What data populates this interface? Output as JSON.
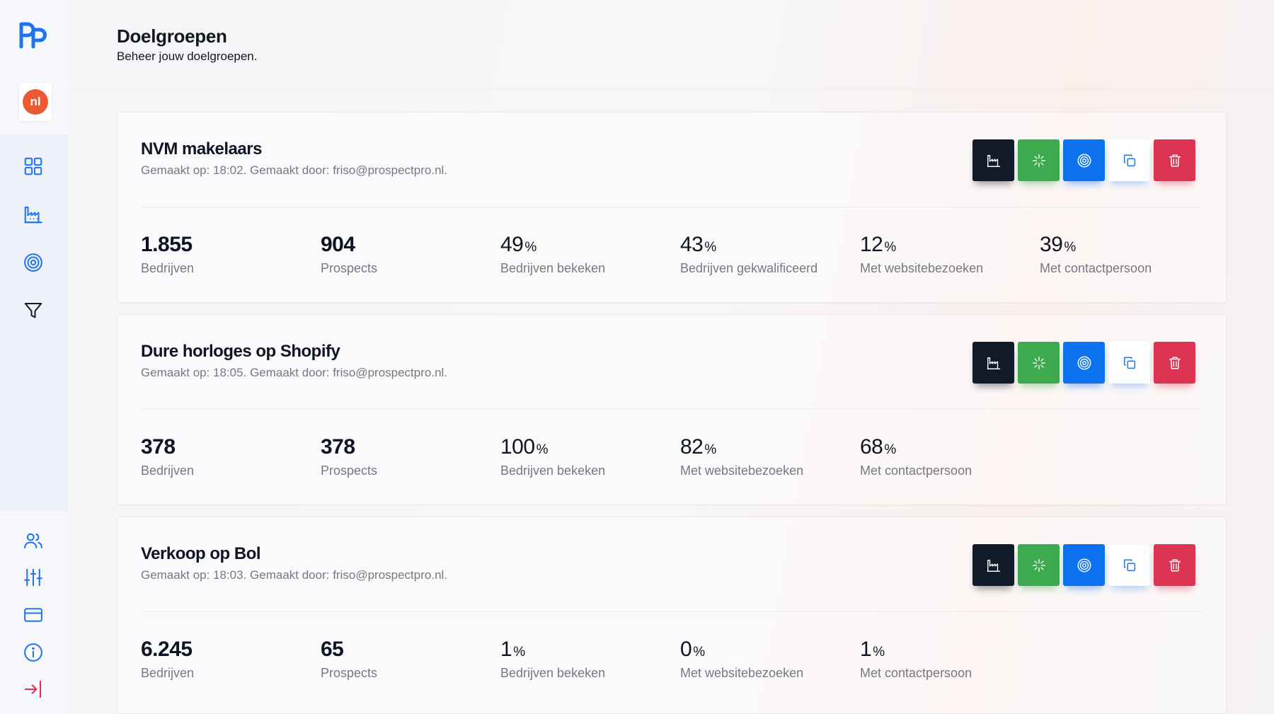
{
  "app": {
    "logo": "prospectpro-logo",
    "language": "nl"
  },
  "nav": {
    "top_icons": [
      "dashboard-icon",
      "companies-icon",
      "target-icon",
      "filter-icon"
    ],
    "bottom_icons": [
      "users-icon",
      "settings-sliders-icon",
      "billing-card-icon",
      "info-icon",
      "logout-icon"
    ]
  },
  "header": {
    "title": "Doelgroepen",
    "subtitle": "Beheer jouw doelgroepen."
  },
  "colors": {
    "dark": "#111a28",
    "green": "#3daa4f",
    "blue": "#0c72f0",
    "red": "#dc3352",
    "accent_orange": "#ec5a33"
  },
  "action_icons": [
    "companies-icon",
    "sparkle-icon",
    "target-icon",
    "copy-icon",
    "trash-icon"
  ],
  "cards": [
    {
      "title": "NVM makelaars",
      "meta": "Gemaakt op: 18:02. Gemaakt door: friso@prospectpro.nl.",
      "stats": [
        {
          "value": "1.855",
          "pct": "",
          "label": "Bedrijven"
        },
        {
          "value": "904",
          "pct": "",
          "label": "Prospects"
        },
        {
          "value": "49",
          "pct": "%",
          "label": "Bedrijven bekeken"
        },
        {
          "value": "43",
          "pct": "%",
          "label": "Bedrijven gekwalificeerd"
        },
        {
          "value": "12",
          "pct": "%",
          "label": "Met websitebezoeken"
        },
        {
          "value": "39",
          "pct": "%",
          "label": "Met contactpersoon"
        }
      ]
    },
    {
      "title": "Dure horloges op Shopify",
      "meta": "Gemaakt op: 18:05. Gemaakt door: friso@prospectpro.nl.",
      "stats": [
        {
          "value": "378",
          "pct": "",
          "label": "Bedrijven"
        },
        {
          "value": "378",
          "pct": "",
          "label": "Prospects"
        },
        {
          "value": "100",
          "pct": "%",
          "label": "Bedrijven bekeken"
        },
        {
          "value": "82",
          "pct": "%",
          "label": "Met websitebezoeken"
        },
        {
          "value": "68",
          "pct": "%",
          "label": "Met contactpersoon"
        }
      ]
    },
    {
      "title": "Verkoop op Bol",
      "meta": "Gemaakt op: 18:03. Gemaakt door: friso@prospectpro.nl.",
      "stats": [
        {
          "value": "6.245",
          "pct": "",
          "label": "Bedrijven"
        },
        {
          "value": "65",
          "pct": "",
          "label": "Prospects"
        },
        {
          "value": "1",
          "pct": "%",
          "label": "Bedrijven bekeken"
        },
        {
          "value": "0",
          "pct": "%",
          "label": "Met websitebezoeken"
        },
        {
          "value": "1",
          "pct": "%",
          "label": "Met contactpersoon"
        }
      ]
    }
  ]
}
